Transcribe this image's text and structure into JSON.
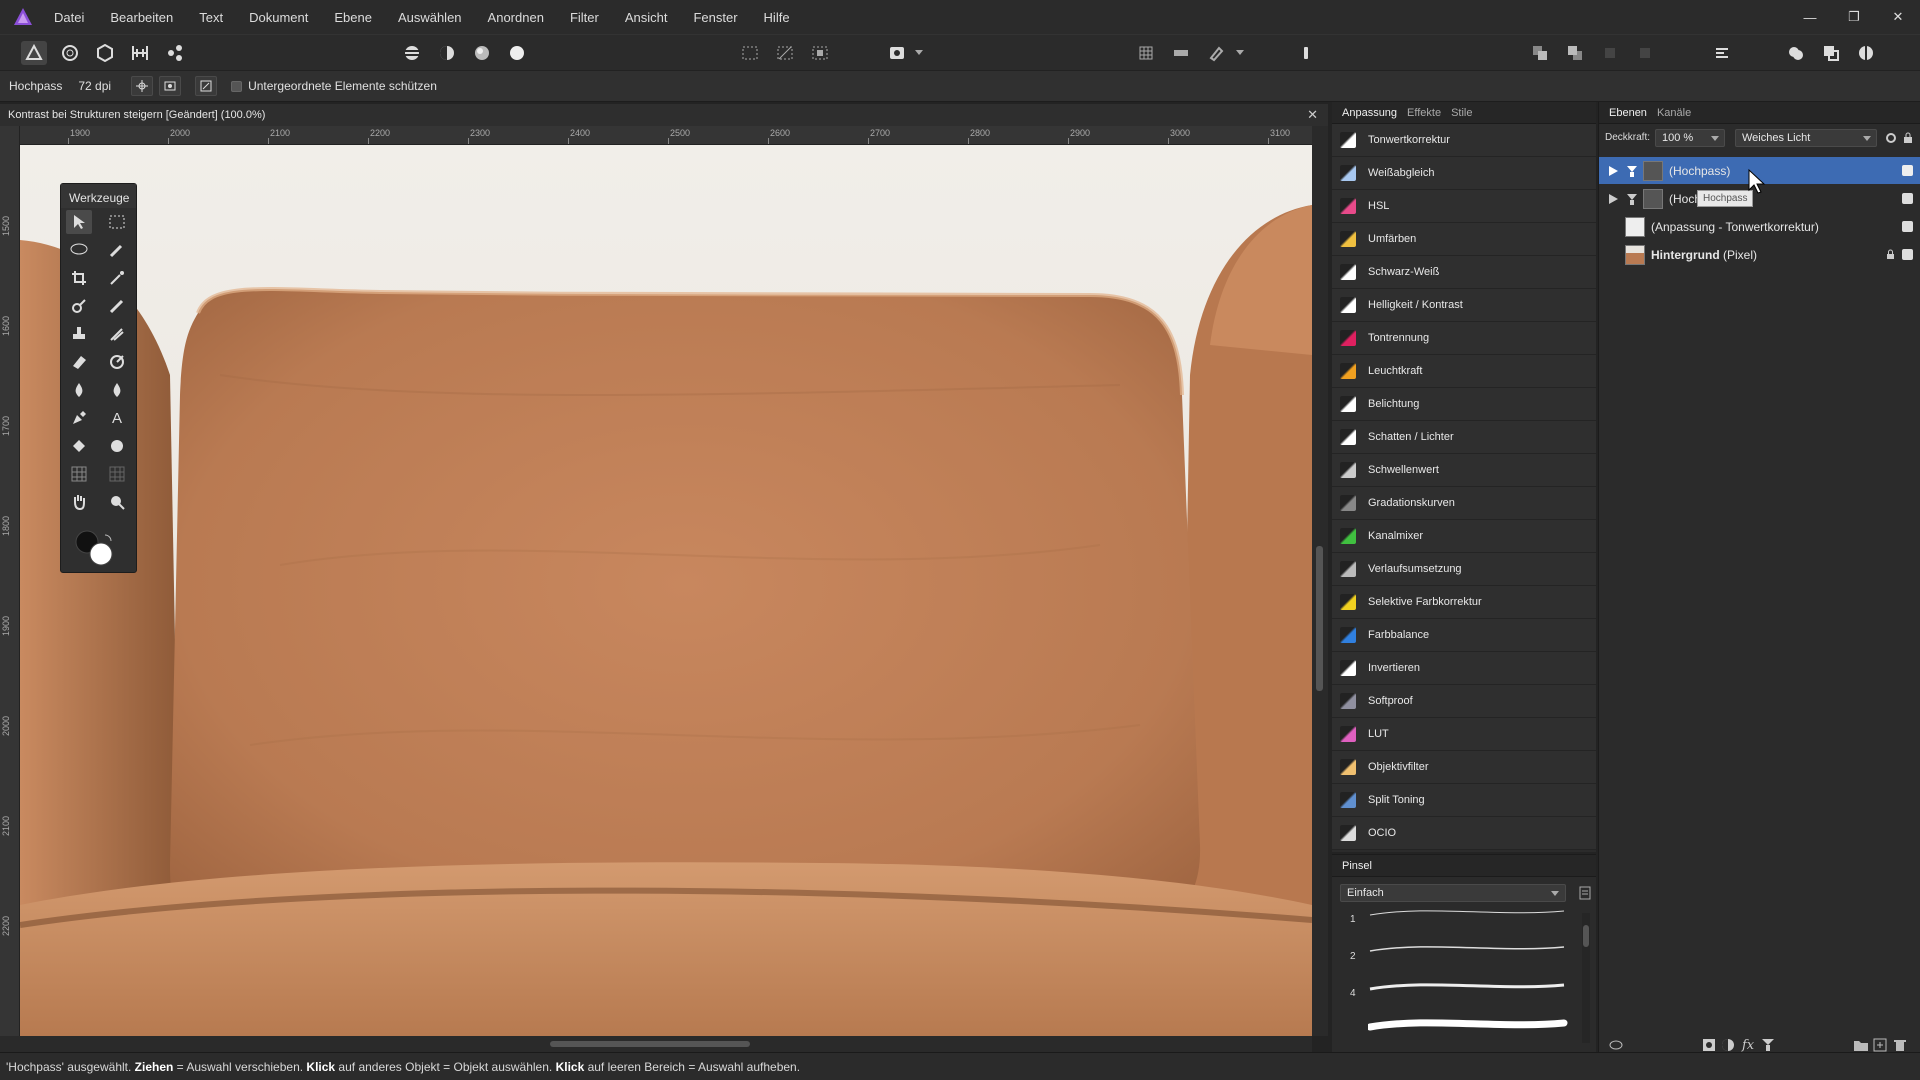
{
  "menu": [
    "Datei",
    "Bearbeiten",
    "Text",
    "Dokument",
    "Ebene",
    "Auswählen",
    "Anordnen",
    "Filter",
    "Ansicht",
    "Fenster",
    "Hilfe"
  ],
  "window_controls": [
    "—",
    "❐",
    "✕"
  ],
  "context": {
    "tool_name": "Hochpass",
    "dpi": "72 dpi",
    "protect_label": "Untergeordnete Elemente schützen"
  },
  "document": {
    "tab_title": "Kontrast bei Strukturen steigern [Geändert] (100.0%)",
    "close": "✕",
    "ruler_h": [
      "1900",
      "2000",
      "2100",
      "2200",
      "2300",
      "2400",
      "2500",
      "2600",
      "2700",
      "2800",
      "2900",
      "3000",
      "3100"
    ],
    "ruler_v": [
      "1500",
      "1600",
      "1700",
      "1800",
      "1900",
      "2000",
      "2100",
      "2200"
    ]
  },
  "tools_panel": {
    "title": "Werkzeuge",
    "text_tool_glyph": "A"
  },
  "adjustment_panel": {
    "tabs": [
      "Anpassung",
      "Effekte",
      "Stile"
    ],
    "items": [
      {
        "label": "Tonwertkorrektur",
        "color": "#ffffff"
      },
      {
        "label": "Weißabgleich",
        "color": "#a8c8f0"
      },
      {
        "label": "HSL",
        "color": "#e84a8a"
      },
      {
        "label": "Umfärben",
        "color": "#f0c040"
      },
      {
        "label": "Schwarz-Weiß",
        "color": "#ffffff"
      },
      {
        "label": "Helligkeit / Kontrast",
        "color": "#ffffff"
      },
      {
        "label": "Tontrennung",
        "color": "#e02060"
      },
      {
        "label": "Leuchtkraft",
        "color": "#f0a020"
      },
      {
        "label": "Belichtung",
        "color": "#ffffff"
      },
      {
        "label": "Schatten / Lichter",
        "color": "#ffffff"
      },
      {
        "label": "Schwellenwert",
        "color": "#cccccc"
      },
      {
        "label": "Gradationskurven",
        "color": "#888888"
      },
      {
        "label": "Kanalmixer",
        "color": "#40c040"
      },
      {
        "label": "Verlaufsumsetzung",
        "color": "#bbbbbb"
      },
      {
        "label": "Selektive Farbkorrektur",
        "color": "#f0d020"
      },
      {
        "label": "Farbbalance",
        "color": "#3080e0"
      },
      {
        "label": "Invertieren",
        "color": "#ffffff"
      },
      {
        "label": "Softproof",
        "color": "#9090a0"
      },
      {
        "label": "LUT",
        "color": "#e060c0"
      },
      {
        "label": "Objektivfilter",
        "color": "#f0c070"
      },
      {
        "label": "Split Toning",
        "color": "#6090d0"
      },
      {
        "label": "OCIO",
        "color": "#dddddd"
      }
    ]
  },
  "brush_panel": {
    "title": "Pinsel",
    "category": "Einfach",
    "sizes": [
      "1",
      "2",
      "4"
    ]
  },
  "layers_panel": {
    "tabs": [
      "Ebenen",
      "Kanäle"
    ],
    "opacity_label": "Deckkraft:",
    "opacity_value": "100 %",
    "blend_mode": "Weiches Licht",
    "tooltip": "Hochpass",
    "layers": [
      {
        "name": "(Hochpass)",
        "selected": true
      },
      {
        "name": "(Hochpass)",
        "selected": false
      },
      {
        "name": "(Anpassung - Tonwertkorrektur)",
        "selected": false
      },
      {
        "name": "Hintergrund",
        "suffix": " (Pixel)",
        "selected": false
      }
    ]
  },
  "status": {
    "p1": "'Hochpass' ausgewählt. ",
    "b1": "Ziehen",
    "p2": " = Auswahl verschieben. ",
    "b2": "Klick",
    "p3": " auf anderes Objekt = Objekt auswählen. ",
    "b3": "Klick",
    "p4": " auf leeren Bereich = Auswahl aufheben."
  }
}
